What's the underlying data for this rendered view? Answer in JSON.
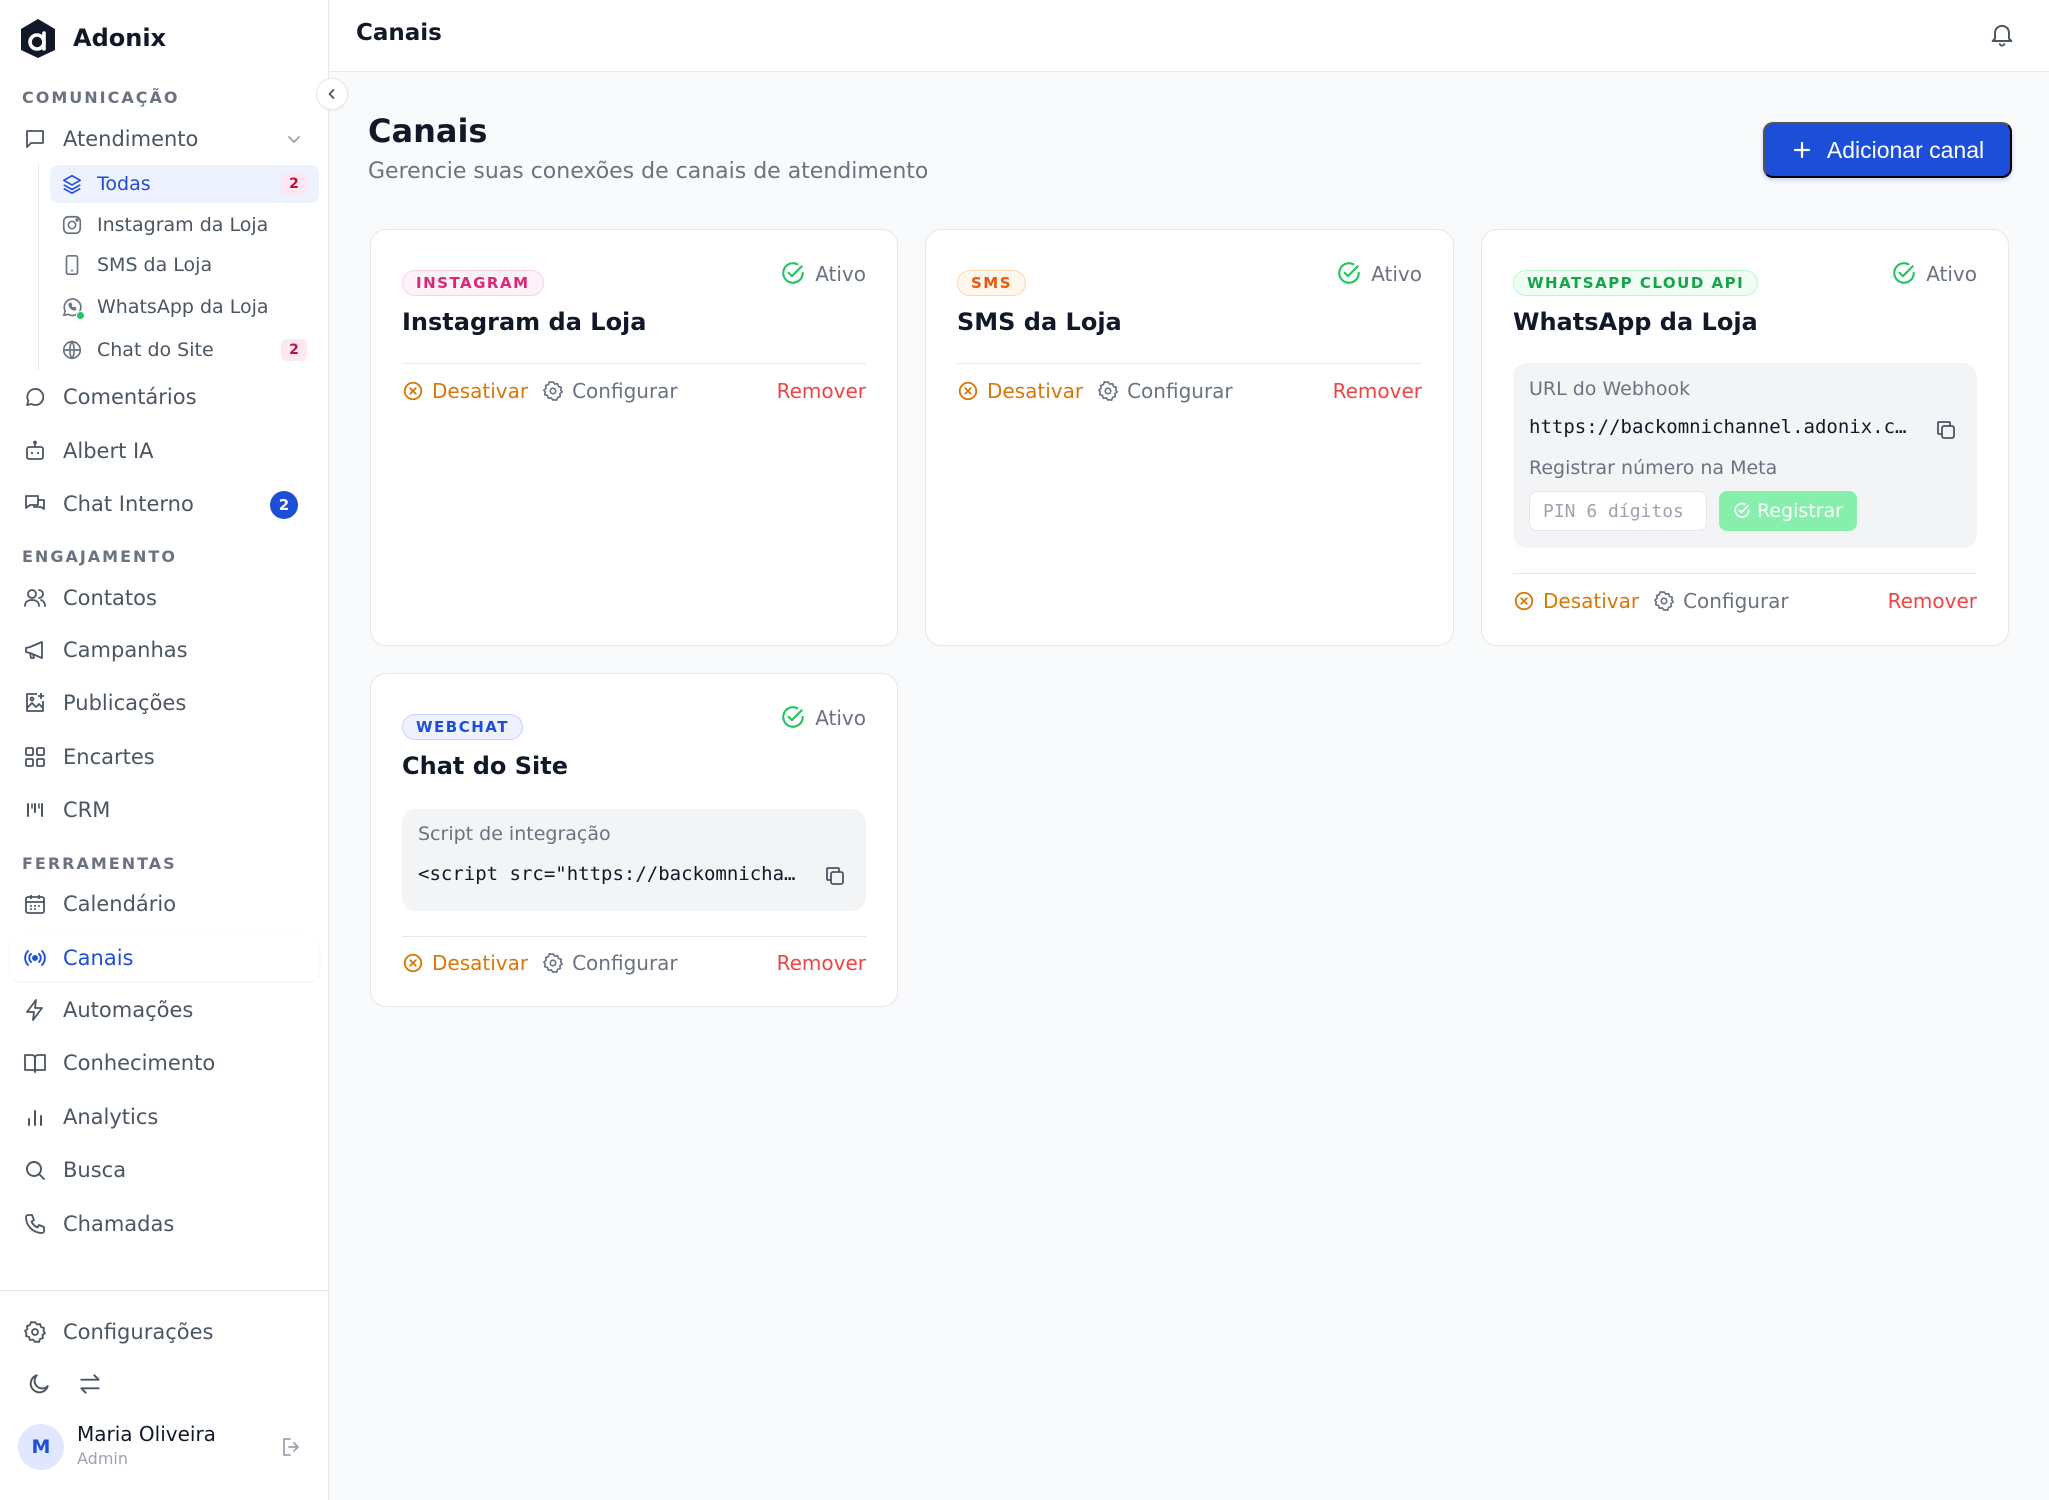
{
  "app": {
    "name": "Adonix"
  },
  "sidebar": {
    "sections": {
      "communication": "COMUNICAÇÃO",
      "engagement": "ENGAJAMENTO",
      "tools": "FERRAMENTAS"
    },
    "atendimento": {
      "label": "Atendimento",
      "children": [
        {
          "label": "Todas",
          "badge": "2",
          "icon": "layers-icon"
        },
        {
          "label": "Instagram da Loja",
          "icon": "instagram-icon"
        },
        {
          "label": "SMS da Loja",
          "icon": "phone-icon"
        },
        {
          "label": "WhatsApp da Loja",
          "icon": "whatsapp-icon"
        },
        {
          "label": "Chat do Site",
          "badge": "2",
          "icon": "globe-icon"
        }
      ]
    },
    "items": {
      "comentarios": "Comentários",
      "albert": "Albert IA",
      "chat_interno": "Chat Interno",
      "chat_interno_badge": "2",
      "contatos": "Contatos",
      "campanhas": "Campanhas",
      "publicacoes": "Publicações",
      "encartes": "Encartes",
      "crm": "CRM",
      "calendario": "Calendário",
      "canais": "Canais",
      "automacoes": "Automações",
      "conhecimento": "Conhecimento",
      "analytics": "Analytics",
      "busca": "Busca",
      "chamadas": "Chamadas"
    },
    "footer": {
      "settings": "Configurações",
      "user": {
        "initial": "M",
        "name": "Maria Oliveira",
        "role": "Admin"
      }
    }
  },
  "topbar": {
    "title": "Canais"
  },
  "page": {
    "title": "Canais",
    "subtitle": "Gerencie suas conexões de canais de atendimento",
    "add_button": "Adicionar canal"
  },
  "labels": {
    "active": "Ativo",
    "disable": "Desativar",
    "configure": "Configurar",
    "remove": "Remover"
  },
  "cards": {
    "instagram": {
      "chip": "INSTAGRAM",
      "title": "Instagram da Loja"
    },
    "sms": {
      "chip": "SMS",
      "title": "SMS da Loja"
    },
    "whatsapp": {
      "chip": "WHATSAPP CLOUD API",
      "title": "WhatsApp da Loja",
      "webhook_label": "URL do Webhook",
      "webhook_url": "https://backomnichannel.adonix.c…",
      "register_label": "Registrar número na Meta",
      "pin_placeholder": "PIN 6 dígitos",
      "register_button": "Registrar"
    },
    "webchat": {
      "chip": "WEBCHAT",
      "title": "Chat do Site",
      "script_label": "Script de integração",
      "script_code": "<script src=\"https://backomnicha…"
    }
  },
  "colors": {
    "primary": "#1d4ed8",
    "success": "#22c55e",
    "warning": "#d97706",
    "danger": "#ef4444"
  }
}
